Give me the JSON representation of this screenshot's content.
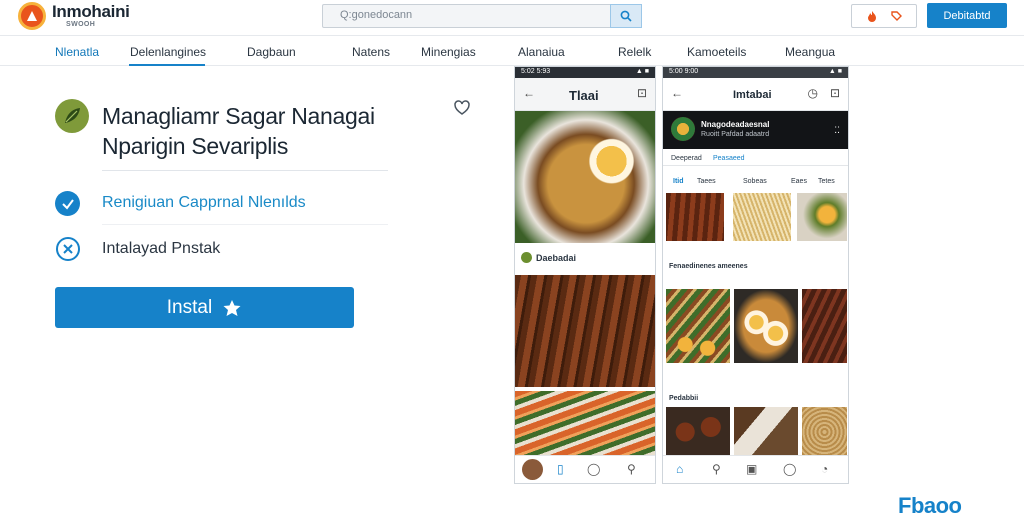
{
  "header": {
    "logo_name": "Inmohaini",
    "logo_sub": "SWOOH",
    "search_placeholder": "Q:gonedocann",
    "download_label": "Debitabtd"
  },
  "nav": {
    "items": [
      "Nlenatla",
      "Delenlangines",
      "Dagbaun",
      "Natens",
      "Minengias",
      "Alanaiua",
      "Relelk",
      "Kamoeteils",
      "Meangua"
    ],
    "active_index": 1
  },
  "app": {
    "title_line1": "Managliamr Sagar Nanagai",
    "title_line2": "Nparigin Sevariplis",
    "feature1": "Renigiuan Capprnal Nlenılds",
    "feature2": "Intalayad Pnstak",
    "install_label": "Instal"
  },
  "phone1": {
    "status_time": "5:02 5:93",
    "title": "Tlaai",
    "section_label": "Daebadai"
  },
  "phone2": {
    "status_time": "5:00 9:00",
    "title": "Imtabai",
    "banner_title": "Nnagodeadaesnal",
    "banner_sub": "Ruoitt Pafdad adaatrd",
    "chip1": "Deeperad",
    "chip2": "Peasaeed",
    "filter_labels": [
      "Itid",
      "Taees",
      "Sobeas",
      "Eaes",
      "Tetes"
    ],
    "section1": "Fenaedinenes ameenes",
    "section2": "Pedabbii"
  },
  "footer": {
    "brand": "Fbaoo"
  },
  "colors": {
    "accent": "#1682c9",
    "logo_orange": "#e9541c"
  }
}
